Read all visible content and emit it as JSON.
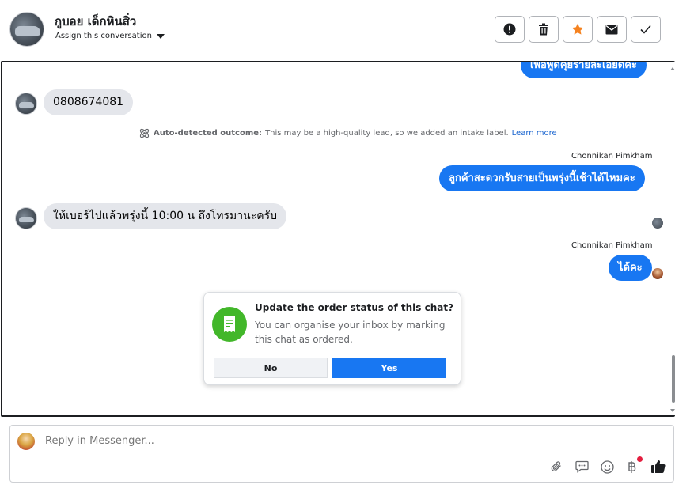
{
  "header": {
    "contact_name": "กูบอย เด็กหินสิ่ว",
    "assign_label": "Assign this conversation"
  },
  "chat": {
    "top_partial_message": "เพื่อพูดคุยรายละเอียดค่ะ",
    "messages": [
      {
        "direction": "in",
        "text": "0808674081"
      },
      {
        "direction": "out",
        "sender": "Chonnikan Pimkham",
        "text": "ลูกค้าสะดวกรับสายเป็นพรุ่งนี้เช้าได้ไหมคะ"
      },
      {
        "direction": "in",
        "text": "ให้เบอร์ไปแล้วพรุ่งนี้ 10:00 น ถึงโทรมานะครับ"
      },
      {
        "direction": "out",
        "sender": "Chonnikan Pimkham",
        "text": "ได้คะ"
      }
    ],
    "outcome": {
      "label": "Auto-detected outcome:",
      "text": "This may be a high-quality lead, so we added an intake label.",
      "link": "Learn more"
    }
  },
  "popup": {
    "title": "Update the order status of this chat?",
    "text": "You can organise your inbox by marking this chat as ordered.",
    "no_label": "No",
    "yes_label": "Yes"
  },
  "composer": {
    "placeholder": "Reply in Messenger..."
  },
  "colors": {
    "accent": "#1877f2",
    "success": "#42b72a",
    "star": "#f5821f",
    "notification": "#e41e3f"
  }
}
